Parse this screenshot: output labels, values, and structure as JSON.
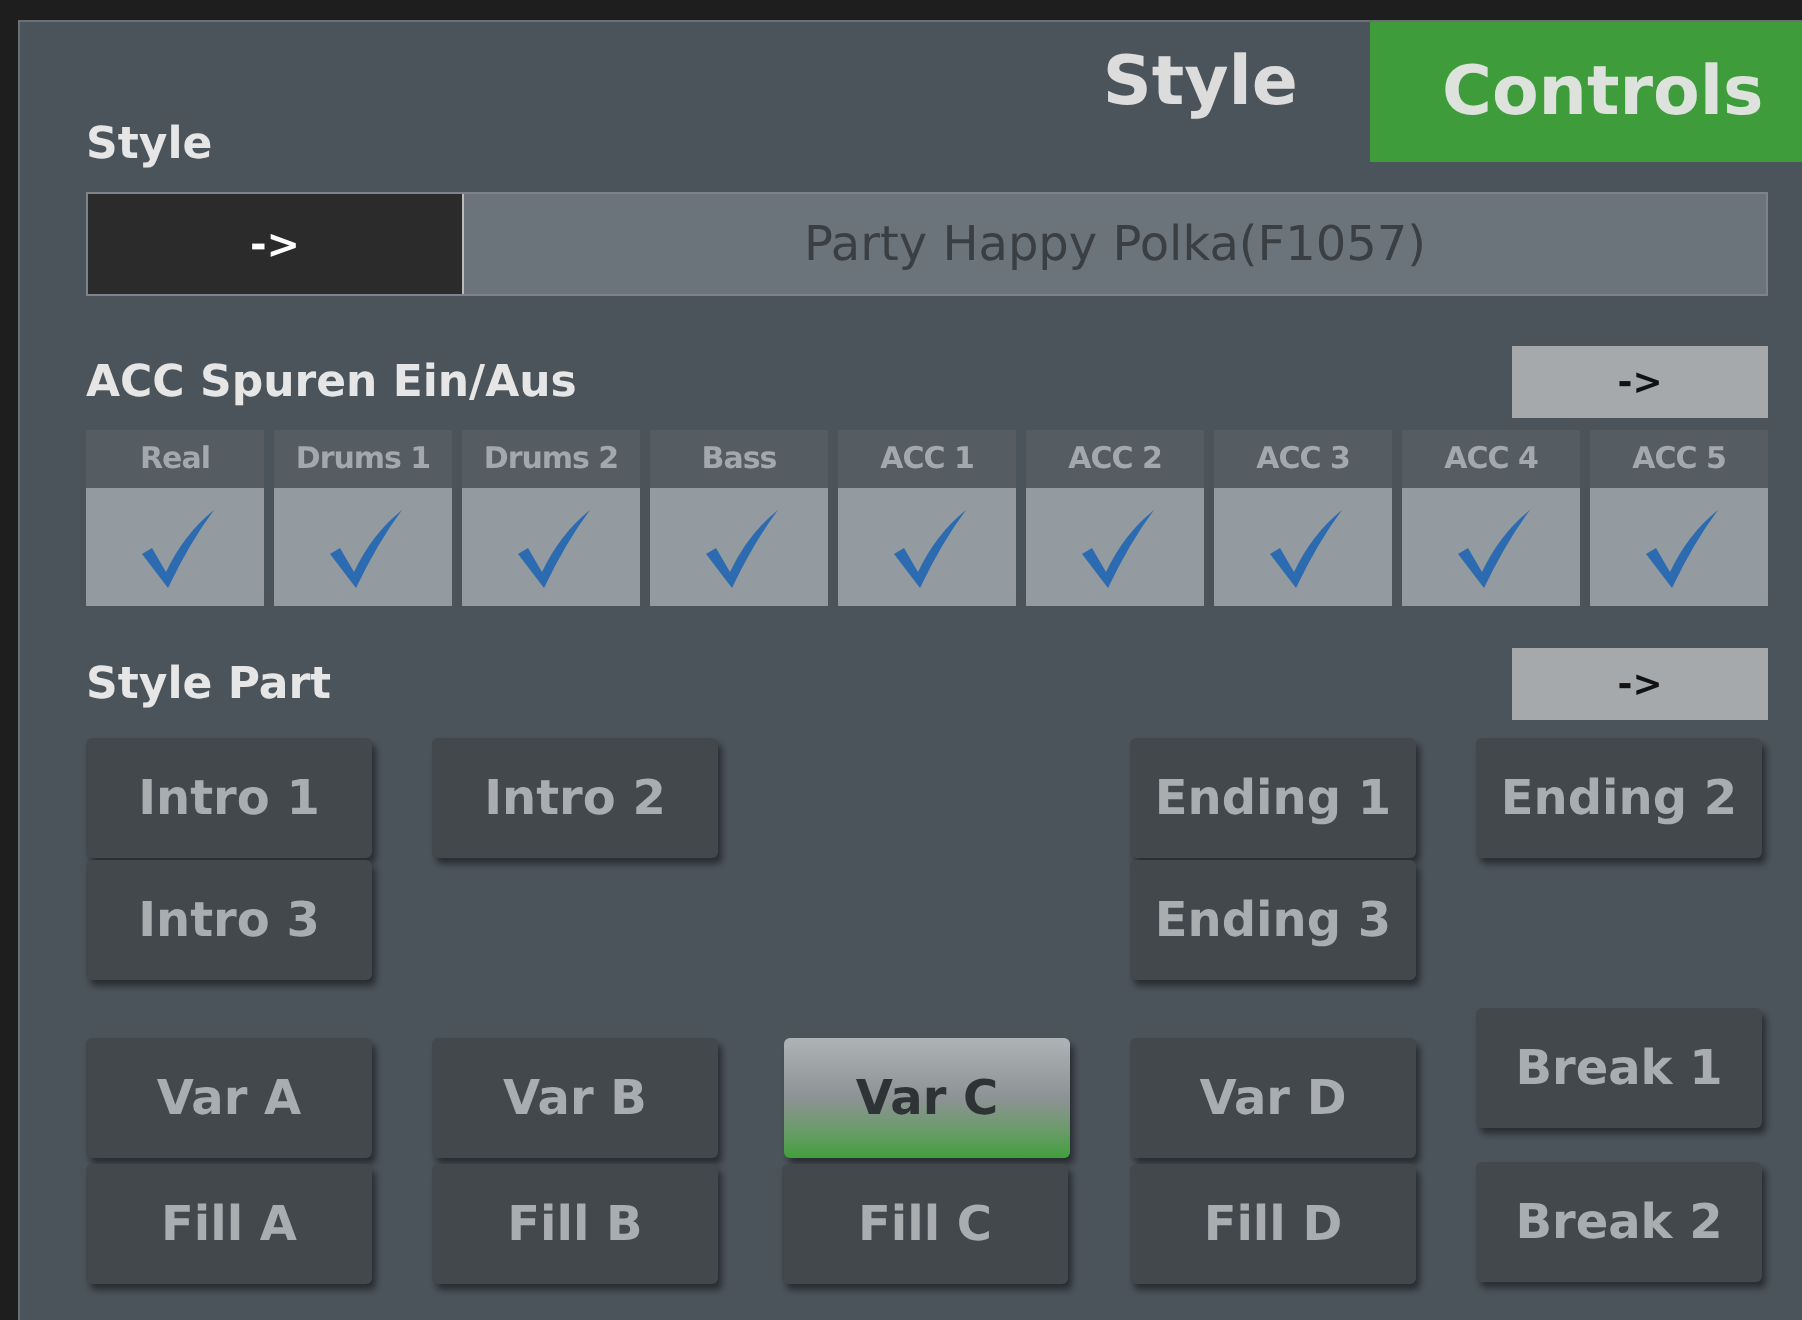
{
  "tabs": [
    {
      "label": "Style",
      "selected": false
    },
    {
      "label": "Controls",
      "selected": true
    }
  ],
  "style_section": {
    "title": "Style",
    "select_button": "->",
    "style_name": "Party Happy Polka(F1057)"
  },
  "acc_tracks": {
    "title": "ACC Spuren Ein/Aus",
    "more_button": "->",
    "tracks": [
      {
        "label": "Real",
        "checked": true
      },
      {
        "label": "Drums 1",
        "checked": true
      },
      {
        "label": "Drums 2",
        "checked": true
      },
      {
        "label": "Bass",
        "checked": true
      },
      {
        "label": "ACC 1",
        "checked": true
      },
      {
        "label": "ACC 2",
        "checked": true
      },
      {
        "label": "ACC 3",
        "checked": true
      },
      {
        "label": "ACC 4",
        "checked": true
      },
      {
        "label": "ACC 5",
        "checked": true
      }
    ]
  },
  "style_part": {
    "title": "Style Part",
    "more_button": "->",
    "intros": [
      {
        "label": "Intro 1",
        "selected": false
      },
      {
        "label": "Intro 2",
        "selected": false
      },
      {
        "label": "Intro 3",
        "selected": false
      }
    ],
    "endings": [
      {
        "label": "Ending 1",
        "selected": false
      },
      {
        "label": "Ending 2",
        "selected": false
      },
      {
        "label": "Ending 3",
        "selected": false
      }
    ],
    "variations": [
      {
        "label": "Var A",
        "selected": false
      },
      {
        "label": "Var B",
        "selected": false
      },
      {
        "label": "Var C",
        "selected": true
      },
      {
        "label": "Var D",
        "selected": false
      }
    ],
    "fills": [
      {
        "label": "Fill A",
        "selected": false
      },
      {
        "label": "Fill B",
        "selected": false
      },
      {
        "label": "Fill C",
        "selected": false
      },
      {
        "label": "Fill D",
        "selected": false
      }
    ],
    "breaks": [
      {
        "label": "Break 1",
        "selected": false
      },
      {
        "label": "Break 2",
        "selected": false
      }
    ]
  }
}
